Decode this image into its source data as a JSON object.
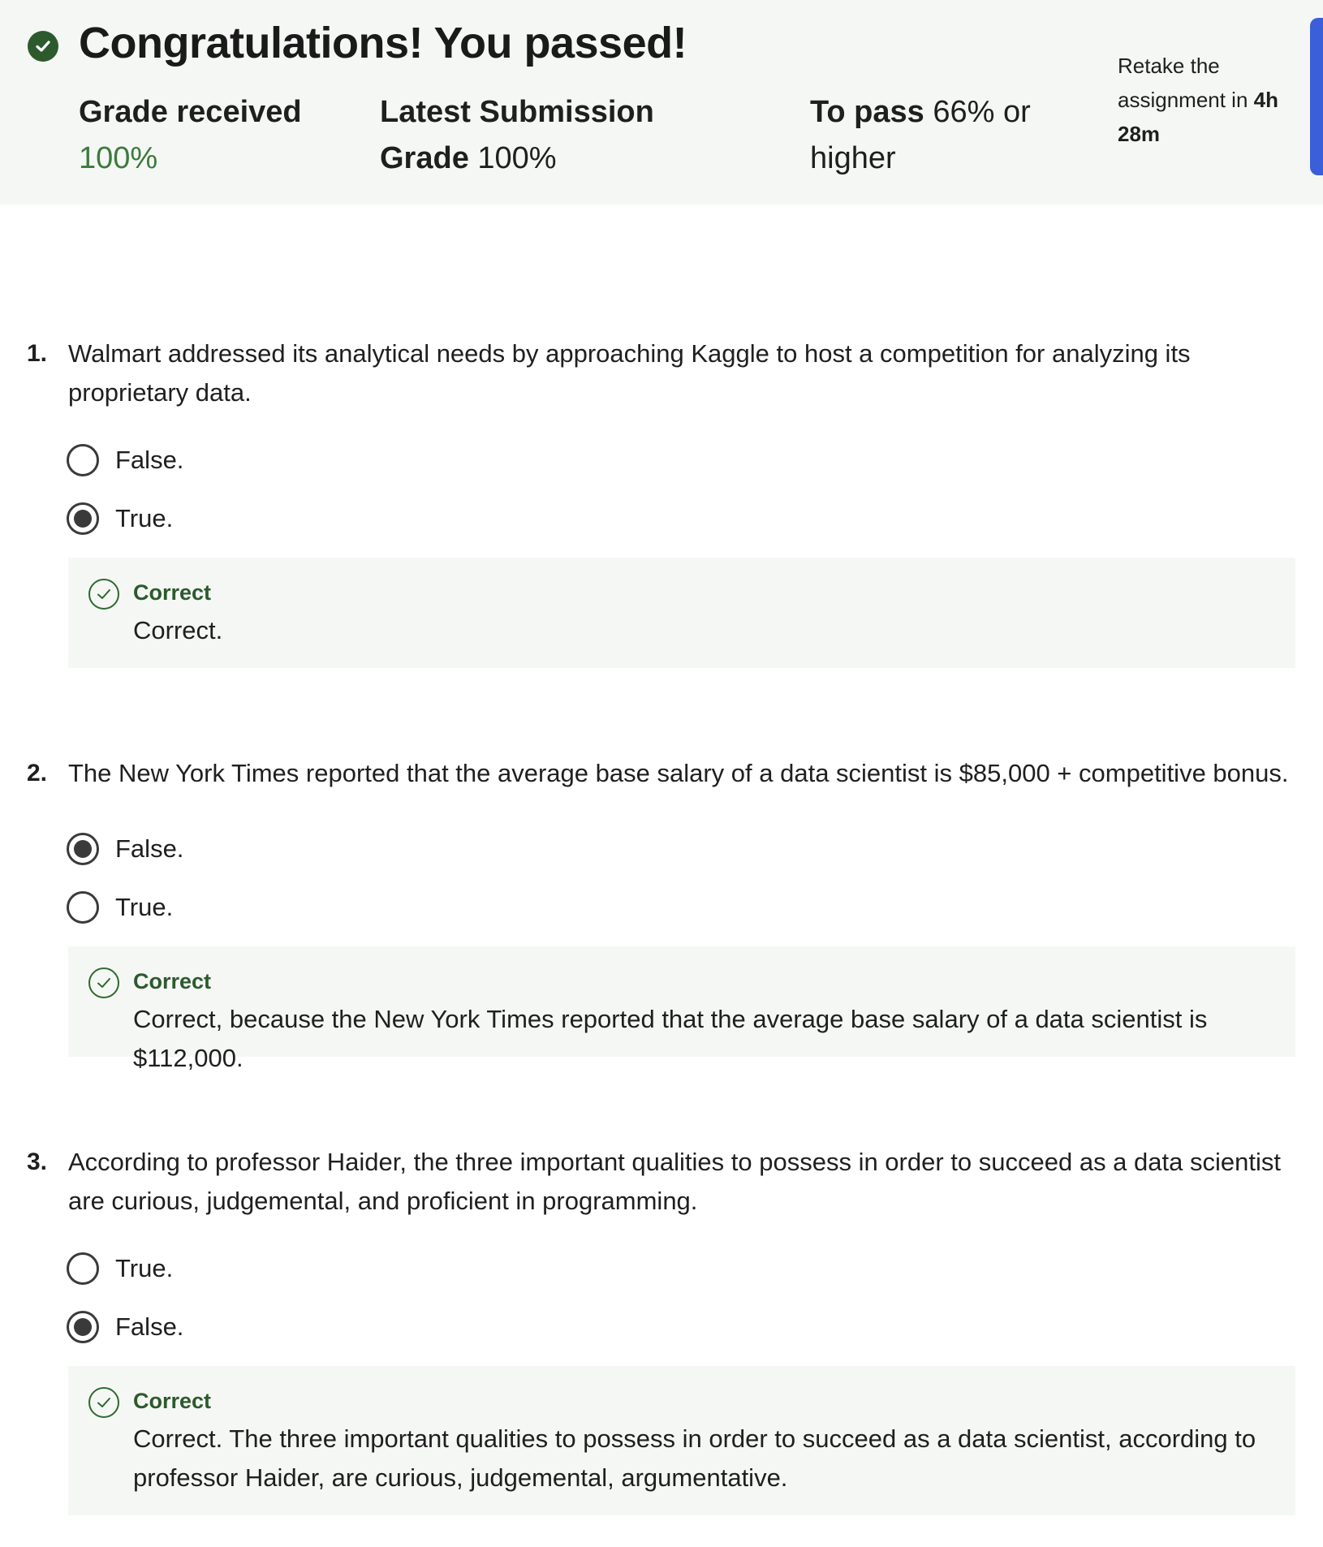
{
  "header": {
    "title": "Congratulations! You passed!",
    "grade_label": "Grade received",
    "grade_value": "100%",
    "latest_label": "Latest Submission Grade",
    "latest_value": "100%",
    "pass_label": "To pass",
    "pass_value": "66% or higher",
    "retake_prefix": "Retake the assignment in",
    "retake_time": "4h 28m"
  },
  "colors": {
    "success_green": "#2d5a2d",
    "grade_green": "#3d7a3d",
    "panel_bg": "#f5f7f5",
    "side_tab_blue": "#3b5fd9"
  },
  "questions": [
    {
      "number": "1.",
      "text": "Walmart addressed its analytical needs by approaching Kaggle to host a competition for analyzing its proprietary data.",
      "options": [
        {
          "label": "False.",
          "selected": false
        },
        {
          "label": "True.",
          "selected": true
        }
      ],
      "feedback": {
        "status": "Correct",
        "text": "Correct."
      }
    },
    {
      "number": "2.",
      "text": "The New York Times reported that the average base salary of a data scientist is $85,000 + competitive bonus.",
      "options": [
        {
          "label": "False.",
          "selected": true
        },
        {
          "label": "True.",
          "selected": false
        }
      ],
      "feedback": {
        "status": "Correct",
        "text": "Correct, because the New York Times reported that the average base salary of a data scientist is $112,000."
      }
    },
    {
      "number": "3.",
      "text": "According to professor Haider, the three important qualities to possess in order to succeed as a data scientist are curious, judgemental, and proficient in programming.",
      "options": [
        {
          "label": "True.",
          "selected": false
        },
        {
          "label": "False.",
          "selected": true
        }
      ],
      "feedback": {
        "status": "Correct",
        "text": "Correct. The three important qualities to possess in order to succeed as a data scientist, according to professor Haider, are curious, judgemental, argumentative."
      }
    }
  ]
}
